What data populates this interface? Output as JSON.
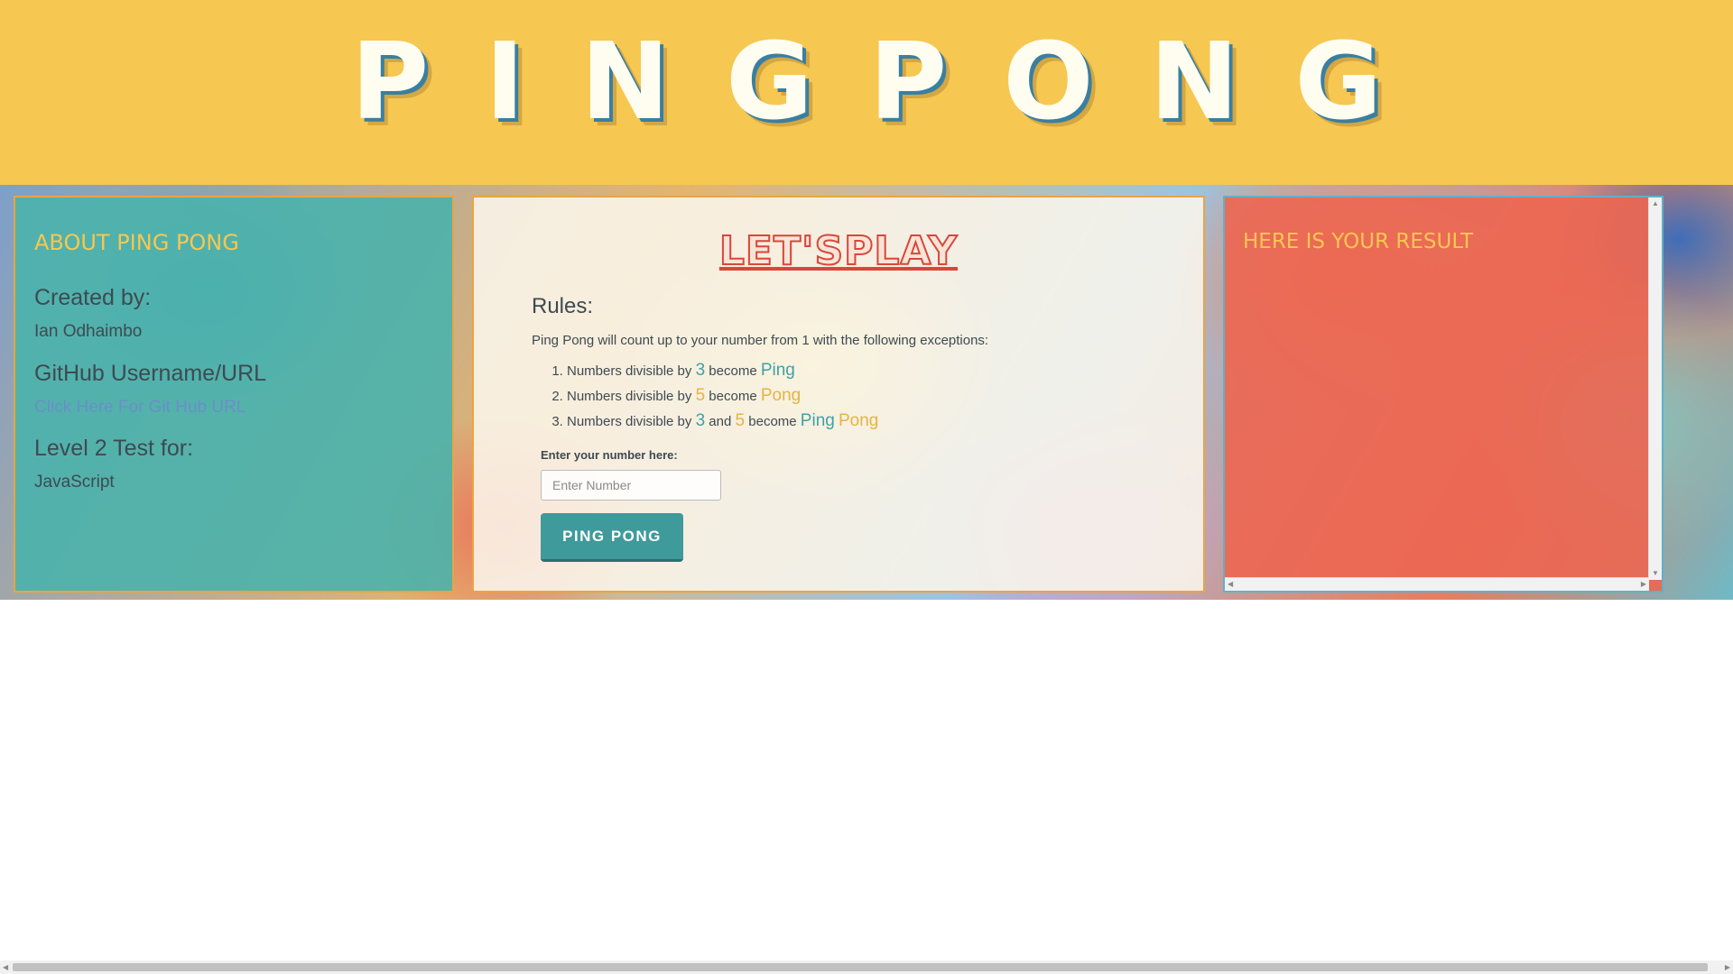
{
  "header": {
    "title": "PINGPONG"
  },
  "about": {
    "heading": "ABOUT PING PONG",
    "created_by_label": "Created by:",
    "created_by_value": "Ian Odhaimbo",
    "github_label": "GitHub Username/URL",
    "github_link": "Click Here For Git Hub URL",
    "level_label": "Level 2 Test for:",
    "level_value": "JavaScript"
  },
  "play": {
    "heading": "LET'SPLAY",
    "rules_title": "Rules:",
    "rules_intro": "Ping Pong will count up to your number from 1 with the following exceptions:",
    "rules": [
      {
        "prefix": "Numbers divisible by ",
        "n1": "3",
        "mid": " become ",
        "w1": "Ping"
      },
      {
        "prefix": "Numbers divisible by ",
        "n1": "5",
        "mid": " become ",
        "w1": "Pong"
      },
      {
        "prefix": "Numbers divisible by ",
        "n1": "3",
        "and": " and ",
        "n2": "5",
        "mid": " become ",
        "w1": "Ping",
        "w2": "Pong"
      }
    ],
    "input_label": "Enter your number here:",
    "input_placeholder": "Enter Number",
    "input_value": "",
    "button_label": "PING PONG"
  },
  "result": {
    "heading": "HERE IS YOUR RESULT"
  },
  "colors": {
    "header_bg": "#f6c751",
    "about_bg": "#4ab2ac",
    "result_bg": "#eb6753",
    "accent_teal": "#3fa1a3",
    "accent_gold": "#e6b344",
    "play_heading": "#d9473b"
  }
}
